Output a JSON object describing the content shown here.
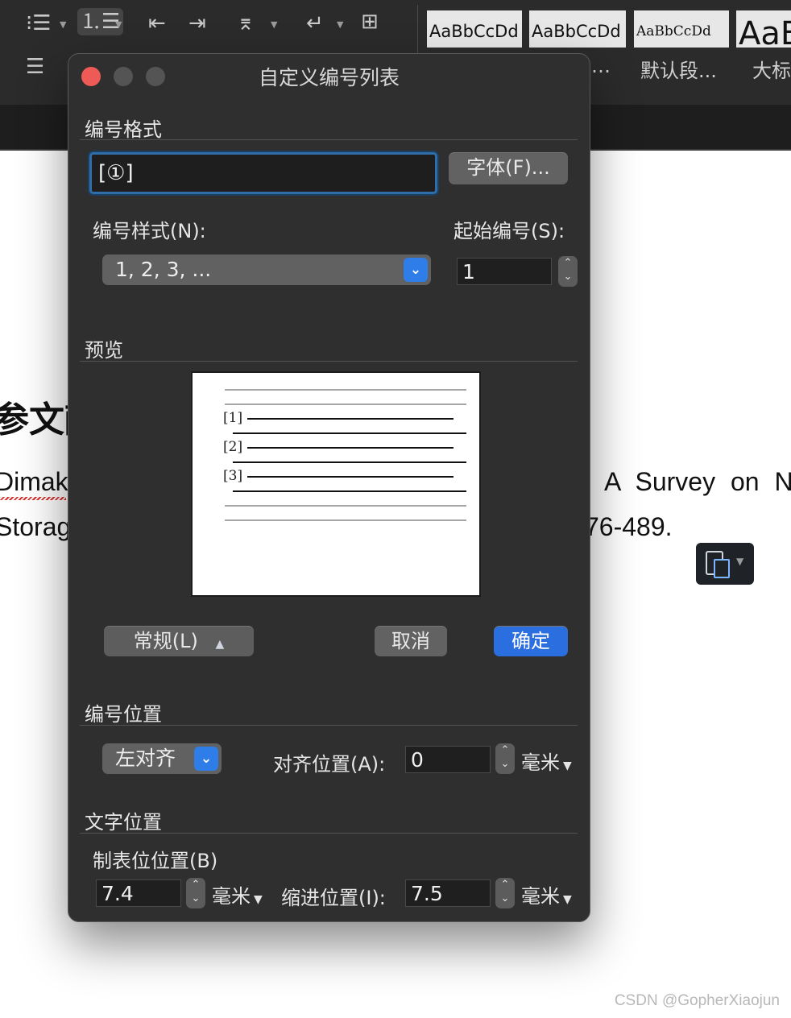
{
  "word": {
    "styles": [
      {
        "preview": "AaBbCcDd",
        "label": ""
      },
      {
        "preview": "AaBbCcDd",
        "label": "…"
      },
      {
        "preview": "AaBbCcDd",
        "label": "默认段..."
      },
      {
        "preview": "AaB",
        "label": "大标"
      }
    ],
    "document": {
      "heading_fragment": "参文献",
      "line1_left": "Dimaki",
      "line1_right": ". A Survey on N",
      "line2_left": "Storag",
      "line2_right": "76-489."
    },
    "watermark": "CSDN @GopherXiaojun"
  },
  "dialog": {
    "title": "自定义编号列表",
    "format_section": "编号格式",
    "format_value": "[①]",
    "font_button": "字体(F)...",
    "style_label": "编号样式(N):",
    "style_value": "1, 2, 3, ...",
    "start_label": "起始编号(S):",
    "start_value": "1",
    "preview_section": "预览",
    "preview_items": [
      "[1]",
      "[2]",
      "[3]"
    ],
    "normal_button": "常规(L)",
    "cancel_button": "取消",
    "ok_button": "确定",
    "position_section": "编号位置",
    "align_value": "左对齐",
    "align_at_label": "对齐位置(A):",
    "align_at_value": "0",
    "unit": "毫米",
    "text_section": "文字位置",
    "tab_label": "制表位位置(B)",
    "tab_value": "7.4",
    "indent_label": "缩进位置(I):",
    "indent_value": "7.5"
  },
  "colors": {
    "dialog_bg": "#2f2f2f",
    "accent_blue": "#2a6ee0",
    "close_red": "#ee5b56"
  }
}
